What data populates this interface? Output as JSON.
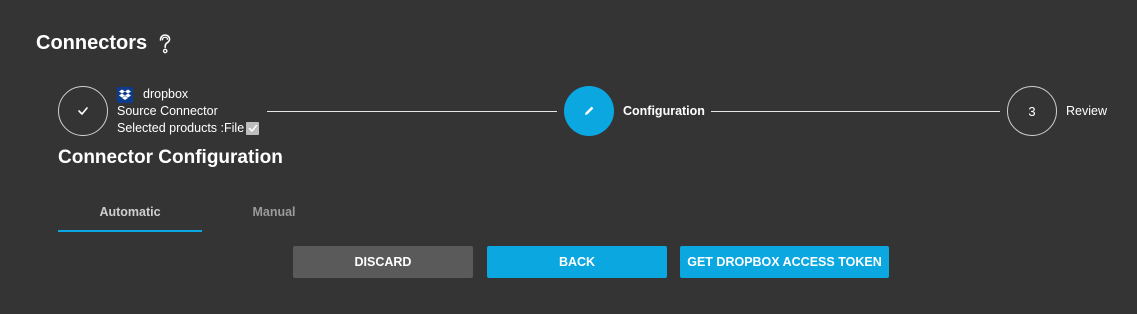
{
  "header": {
    "title": "Connectors",
    "help_icon": "help-question-icon"
  },
  "stepper": {
    "step1": {
      "status": "completed",
      "icon": "check-icon",
      "connector_name": "dropbox",
      "connector_logo": "dropbox-icon",
      "type": "Source Connector",
      "products_label": "Selected products :File",
      "products_checked": true
    },
    "step2": {
      "status": "active",
      "icon": "pencil-icon",
      "label": "Configuration"
    },
    "step3": {
      "status": "pending",
      "number": "3",
      "label": "Review"
    }
  },
  "section": {
    "title": "Connector Configuration"
  },
  "tabs": [
    {
      "label": "Automatic",
      "selected": true
    },
    {
      "label": "Manual",
      "selected": false
    }
  ],
  "buttons": {
    "discard": "DISCARD",
    "back": "BACK",
    "token": "GET DROPBOX ACCESS TOKEN"
  },
  "colors": {
    "background": "#343434",
    "accent": "#0aa7e0",
    "discard_button": "#5a5a5a",
    "dropbox_logo": "#0d3c8f"
  }
}
